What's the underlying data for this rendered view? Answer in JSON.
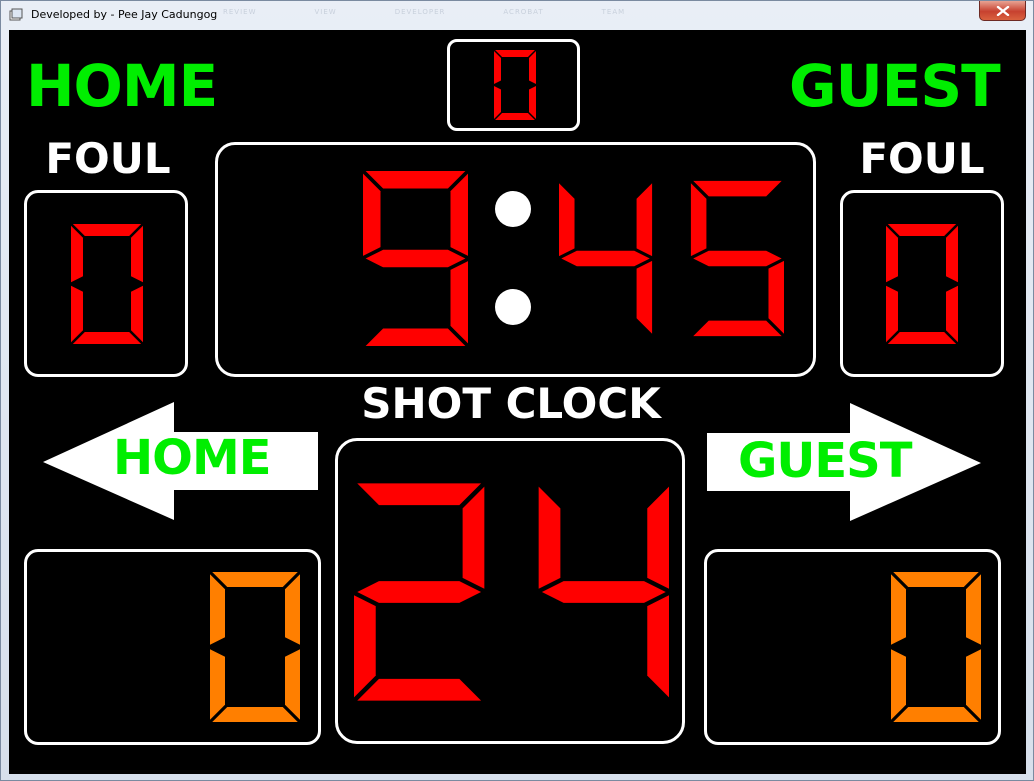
{
  "window": {
    "title": "Developed by - Pee Jay Cadungog",
    "ghost_tabs": [
      "REVIEW",
      "VIEW",
      "DEVELOPER",
      "ACROBAT",
      "TEAM"
    ]
  },
  "scoreboard": {
    "home_title": "HOME",
    "guest_title": "GUEST",
    "period": "0",
    "home_foul_label": "FOUL",
    "guest_foul_label": "FOUL",
    "home_fouls": "0",
    "guest_fouls": "0",
    "game_clock": {
      "minutes": "9",
      "seconds": "45"
    },
    "shot_clock_label": "SHOT CLOCK",
    "shot_clock": "24",
    "possession_home_label": "HOME",
    "possession_guest_label": "GUEST",
    "home_score": "0",
    "guest_score": "0"
  },
  "colors": {
    "team_text": "#00ee00",
    "led_red": "#ff0000",
    "led_orange": "#ff7f00",
    "frame": "#ffffff",
    "board": "#000000"
  }
}
